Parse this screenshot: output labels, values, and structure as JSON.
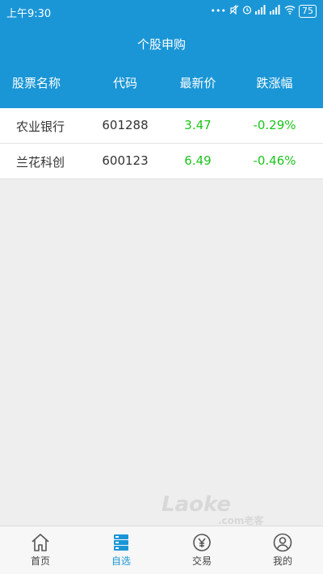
{
  "status": {
    "time": "上午9:30",
    "battery": "75"
  },
  "header": {
    "title": "个股申购"
  },
  "columns": {
    "name": "股票名称",
    "code": "代码",
    "price": "最新价",
    "change": "跌涨幅"
  },
  "rows": [
    {
      "name": "农业银行",
      "code": "601288",
      "price": "3.47",
      "change": "-0.29%"
    },
    {
      "name": "兰花科创",
      "code": "600123",
      "price": "6.49",
      "change": "-0.46%"
    }
  ],
  "watermark": {
    "main": "Laoke",
    "sub": ".com老客"
  },
  "tabs": [
    {
      "label": "首页",
      "icon": "home-icon"
    },
    {
      "label": "自选",
      "icon": "list-icon"
    },
    {
      "label": "交易",
      "icon": "yuan-exchange-icon"
    },
    {
      "label": "我的",
      "icon": "user-icon"
    }
  ],
  "colors": {
    "accent": "#1a96d6",
    "down": "#1cc41c"
  }
}
